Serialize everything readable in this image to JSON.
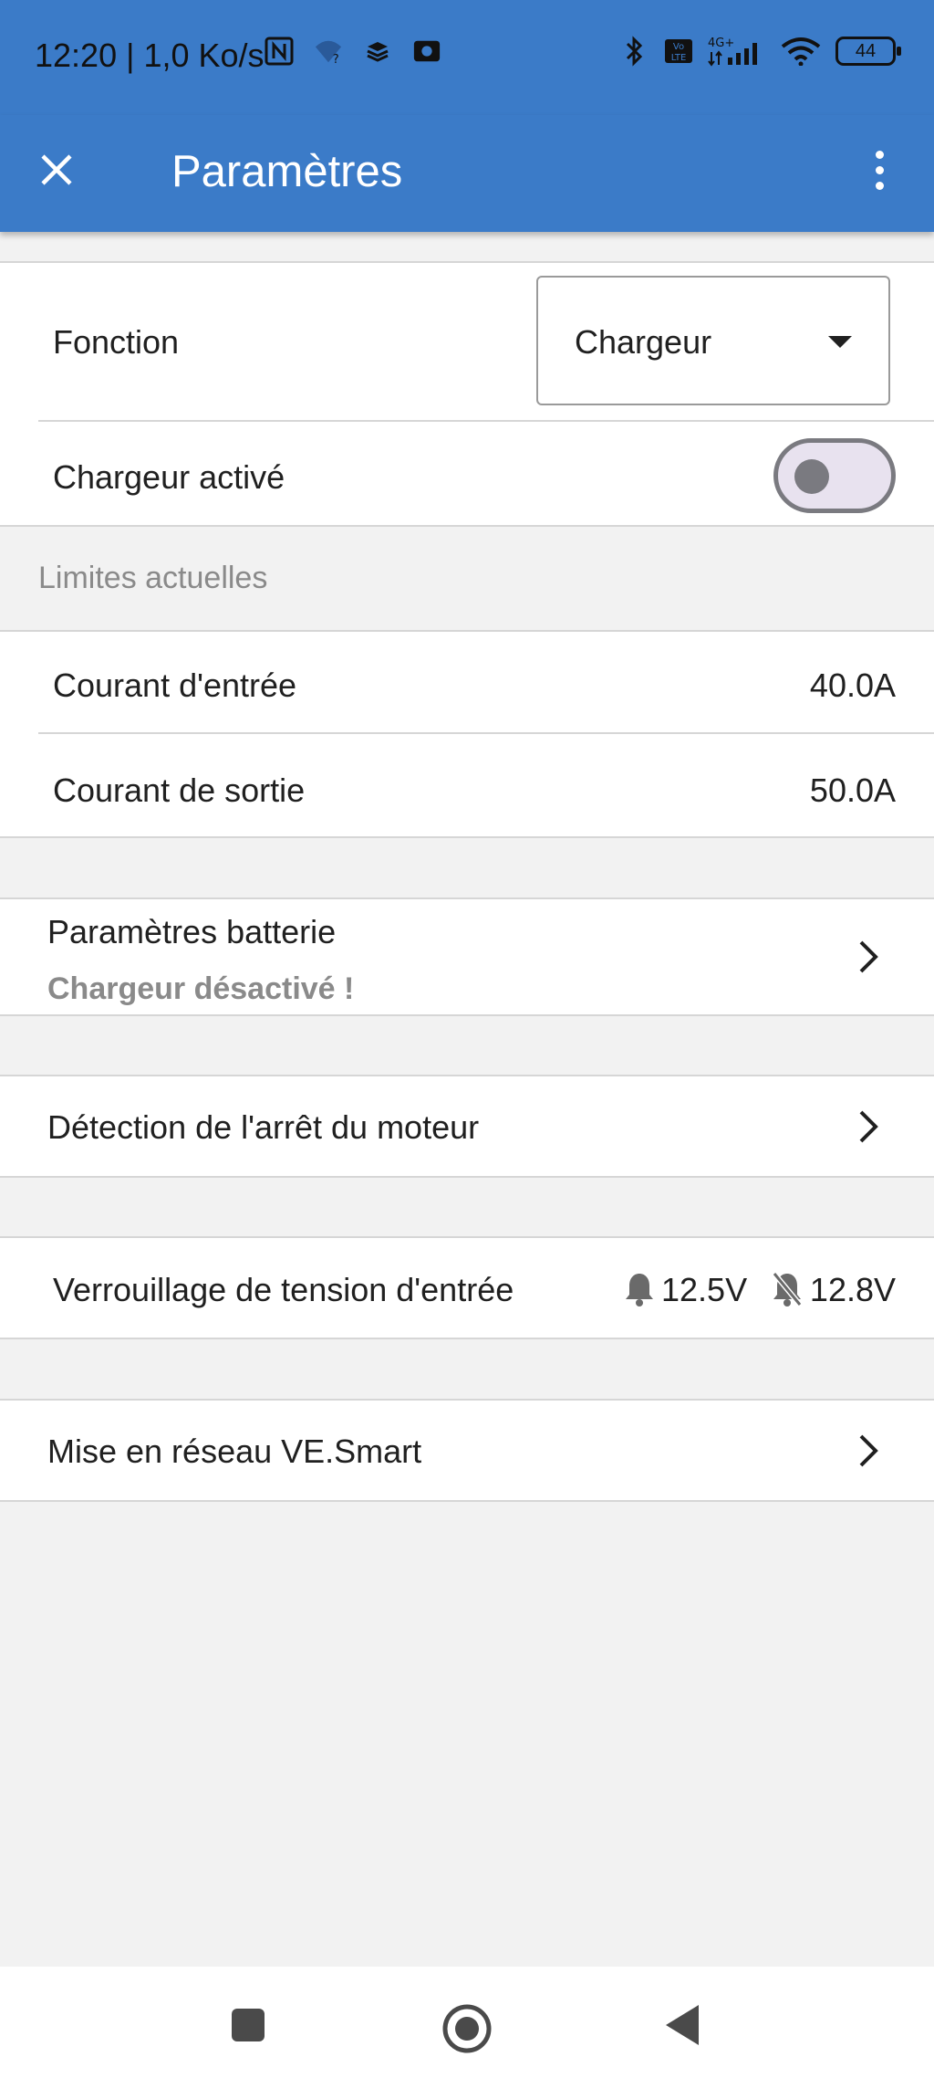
{
  "status_bar": {
    "time_speed": "12:20 | 1,0 Ko/s",
    "battery_level": "44",
    "icons": [
      "nfc-icon",
      "wifi-question-icon",
      "stack-icon",
      "cast-icon",
      "bluetooth-icon",
      "volte-icon",
      "signal-4g-icon",
      "wifi-icon",
      "battery-icon"
    ]
  },
  "appbar": {
    "title": "Paramètres",
    "close_icon": "close-icon",
    "menu_icon": "more-vert-icon",
    "color": "#3b7bc8"
  },
  "function_row": {
    "label": "Fonction",
    "dropdown_value": "Chargeur"
  },
  "charger_row": {
    "label": "Chargeur activé",
    "toggle_on": false
  },
  "limits": {
    "header": "Limites actuelles",
    "input_current_label": "Courant d'entrée",
    "input_current_value": "40.0A",
    "output_current_label": "Courant de sortie",
    "output_current_value": "50.0A"
  },
  "battery_settings": {
    "label": "Paramètres batterie",
    "warning": "Chargeur désactivé !"
  },
  "engine_stop": {
    "label": "Détection de l'arrêt du moteur"
  },
  "voltage_lock": {
    "label": "Verrouillage de tension d'entrée",
    "alarm_on_value": "12.5V",
    "alarm_off_value": "12.8V"
  },
  "networking": {
    "label": "Mise en réseau VE.Smart"
  },
  "nav": {
    "icons": [
      "recents-icon",
      "home-icon",
      "back-icon"
    ]
  }
}
